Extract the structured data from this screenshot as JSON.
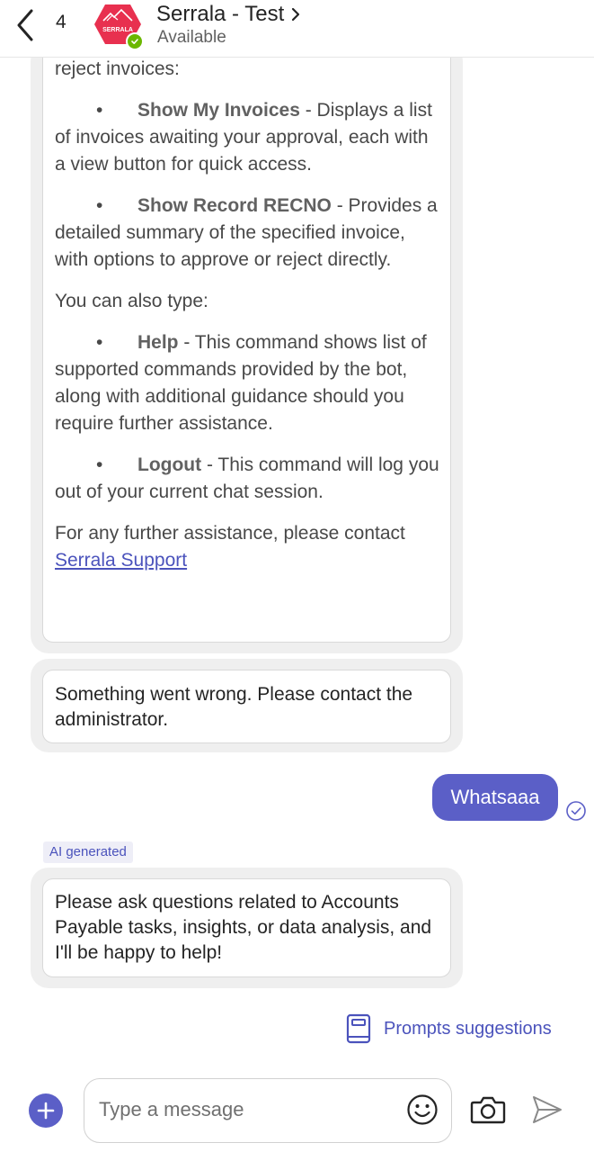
{
  "header": {
    "back_count": "4",
    "avatar_label": "SERRALA",
    "title": "Serrala - Test",
    "status": "Available"
  },
  "messages": {
    "help": {
      "intro_tail": "reject invoices:",
      "items": [
        {
          "cmd": "Show My Invoices",
          "desc": " - Displays a list of invoices awaiting your approval, each with a view button for quick access."
        },
        {
          "cmd": "Show Record RECNO",
          "desc": " - Provides a detailed summary of the specified invoice, with options to approve or reject directly."
        }
      ],
      "also_type": "You can also type:",
      "items2": [
        {
          "cmd": "Help",
          "desc": " - This command shows list of supported commands provided by the bot, along with additional guidance should you require further assistance."
        },
        {
          "cmd": "Logout",
          "desc": " - This command will log you out of your current chat session."
        }
      ],
      "footer_text": "For any further assistance, please contact ",
      "footer_link": "Serrala Support"
    },
    "error": "Something went wrong. Please contact the administrator.",
    "user": "Whatsaaa",
    "ai_tag": "AI generated",
    "reply": "Please ask questions related to Accounts Payable tasks, insights, or data analysis, and I'll be happy to help!"
  },
  "prompts_suggestions": "Prompts suggestions",
  "composer": {
    "placeholder": "Type a message"
  },
  "colors": {
    "accent": "#5b5fc7",
    "link": "#4b53bc",
    "brand": "#e8304f",
    "available": "#6bb700"
  }
}
